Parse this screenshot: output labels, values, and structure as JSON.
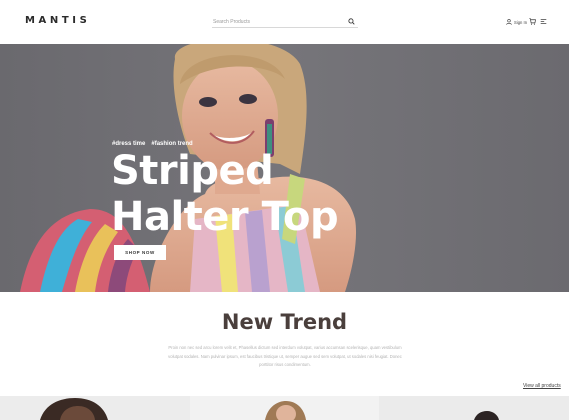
{
  "header": {
    "logo": "MANTIS",
    "search_placeholder": "Search Products",
    "signin_label": "Sign In"
  },
  "hero": {
    "tags": [
      "#dress time",
      "#fashion trend"
    ],
    "headline_line1": "Striped",
    "headline_line2": "Halter Top",
    "button_label": "SHOP NOW"
  },
  "trend": {
    "title": "New Trend",
    "description": "Proin non nec sed arcu lorem velit et, Phasellus dictum sed interdum volutpat, varius accumsan scelerisque, quam vestibulum volutpat sodales. Nam pulvinar ipsum, est faucibus tristique ut, semper augue sed sem volutpat, ut sodales nisi feugiat. Donec porttitor risus condimentum."
  },
  "view_all_label": "View all products",
  "colors": {
    "hero_bg": "#6e6d72",
    "title_color": "#4a3f3c"
  }
}
